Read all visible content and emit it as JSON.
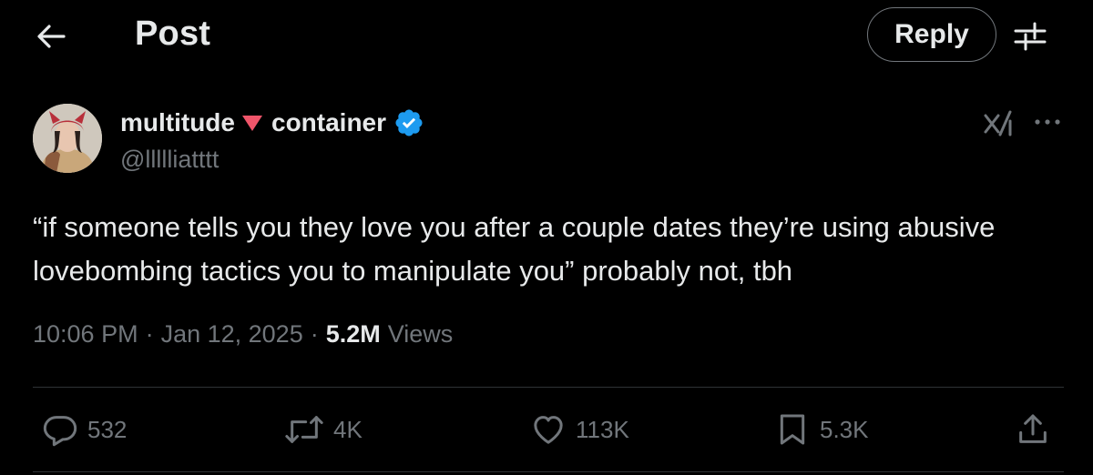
{
  "header": {
    "back_icon": "arrow-left-icon",
    "title": "Post",
    "reply_label": "Reply",
    "adjust_icon": "sliders-icon"
  },
  "author": {
    "name_part1": "multitude",
    "name_emoji": "red-triangle-down-icon",
    "name_part2": "container",
    "verified_icon": "verified-badge-icon",
    "handle": "@llllliatttt"
  },
  "post": {
    "text": "“if someone tells you they love you after a couple dates they’re using abusive lovebombing tactics you to manipulate you” probably not, tbh",
    "time": "10:06 PM",
    "date": "Jan 12, 2025",
    "views_count": "5.2M",
    "views_label": "Views"
  },
  "actions": {
    "replies": "532",
    "reposts": "4K",
    "likes": "113K",
    "bookmarks": "5.3K"
  },
  "colors": {
    "background": "#000000",
    "text_primary": "#e7e9ea",
    "text_secondary": "#71767b",
    "verified_blue": "#1d9bf0",
    "emoji_red": "#f0556a"
  }
}
